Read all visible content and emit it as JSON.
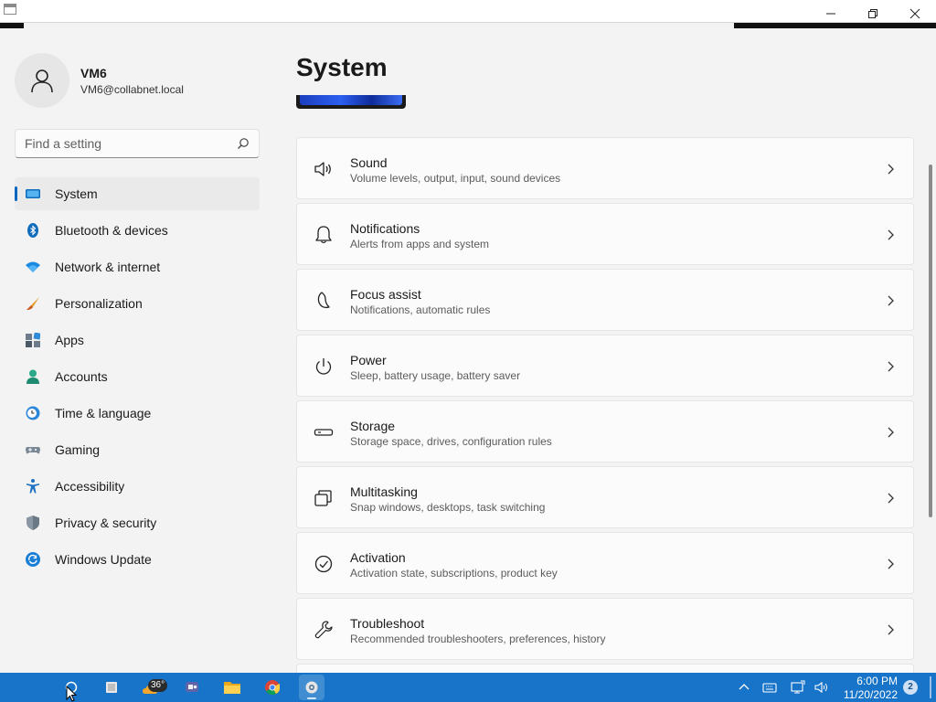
{
  "window": {
    "title": "",
    "controls": {
      "minimize": "minimize",
      "maximize": "restore",
      "close": "close"
    }
  },
  "profile": {
    "name": "VM6",
    "email": "VM6@collabnet.local"
  },
  "search": {
    "placeholder": "Find a setting",
    "value": ""
  },
  "sidebar": {
    "items": [
      {
        "label": "System",
        "icon": "monitor-icon",
        "selected": true
      },
      {
        "label": "Bluetooth & devices",
        "icon": "bluetooth-icon"
      },
      {
        "label": "Network & internet",
        "icon": "wifi-icon"
      },
      {
        "label": "Personalization",
        "icon": "brush-icon"
      },
      {
        "label": "Apps",
        "icon": "apps-icon"
      },
      {
        "label": "Accounts",
        "icon": "person-icon"
      },
      {
        "label": "Time & language",
        "icon": "clock-globe-icon"
      },
      {
        "label": "Gaming",
        "icon": "gamepad-icon"
      },
      {
        "label": "Accessibility",
        "icon": "accessibility-icon"
      },
      {
        "label": "Privacy & security",
        "icon": "shield-icon"
      },
      {
        "label": "Windows Update",
        "icon": "update-icon"
      }
    ]
  },
  "main": {
    "title": "System",
    "cards": [
      {
        "title": "Sound",
        "subtitle": "Volume levels, output, input, sound devices",
        "icon": "speaker-icon"
      },
      {
        "title": "Notifications",
        "subtitle": "Alerts from apps and system",
        "icon": "bell-icon"
      },
      {
        "title": "Focus assist",
        "subtitle": "Notifications, automatic rules",
        "icon": "moon-icon"
      },
      {
        "title": "Power",
        "subtitle": "Sleep, battery usage, battery saver",
        "icon": "power-icon"
      },
      {
        "title": "Storage",
        "subtitle": "Storage space, drives, configuration rules",
        "icon": "drive-icon"
      },
      {
        "title": "Multitasking",
        "subtitle": "Snap windows, desktops, task switching",
        "icon": "multitask-icon"
      },
      {
        "title": "Activation",
        "subtitle": "Activation state, subscriptions, product key",
        "icon": "check-circle-icon"
      },
      {
        "title": "Troubleshoot",
        "subtitle": "Recommended troubleshooters, preferences, history",
        "icon": "wrench-icon"
      }
    ]
  },
  "taskbar": {
    "weather_temp": "36°",
    "time": "6:00 PM",
    "date": "11/20/2022",
    "notification_count": "2"
  },
  "colors": {
    "accent": "#0067c0",
    "taskbar": "#1874c8",
    "background": "#f3f3f3",
    "card": "#fbfbfb"
  }
}
